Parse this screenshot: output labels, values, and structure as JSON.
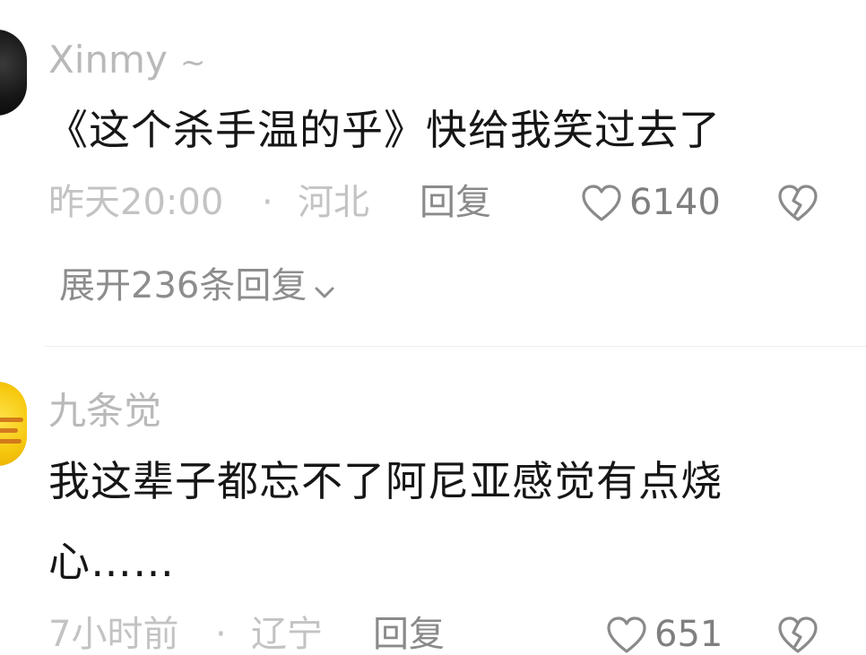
{
  "comments": [
    {
      "username": "Xinmy",
      "username_suffix": "~",
      "text": "《这个杀手温的乎》快给我笑过去了",
      "time": "昨天20:00",
      "separator": "·",
      "location": "河北",
      "reply_label": "回复",
      "likes": "6140",
      "expand_replies": "展开236条回复",
      "avatar_color": "#111111",
      "icons": [
        "heart-icon",
        "broken-heart-icon",
        "chevron-down-icon"
      ]
    },
    {
      "username": "九条觉",
      "text_line1": "我这辈子都忘不了阿尼亚感觉有点烧",
      "text_line2": "心……",
      "time": "7小时前",
      "separator": "·",
      "location": "辽宁",
      "reply_label": "回复",
      "likes": "651",
      "avatar_color": "#f6c90f",
      "icons": [
        "heart-icon",
        "broken-heart-icon"
      ]
    }
  ],
  "colors": {
    "background": "#ffffff",
    "username": "#b9b9b9",
    "content": "#161616",
    "meta": "#c3c3c3",
    "action": "#8a8a8a"
  }
}
